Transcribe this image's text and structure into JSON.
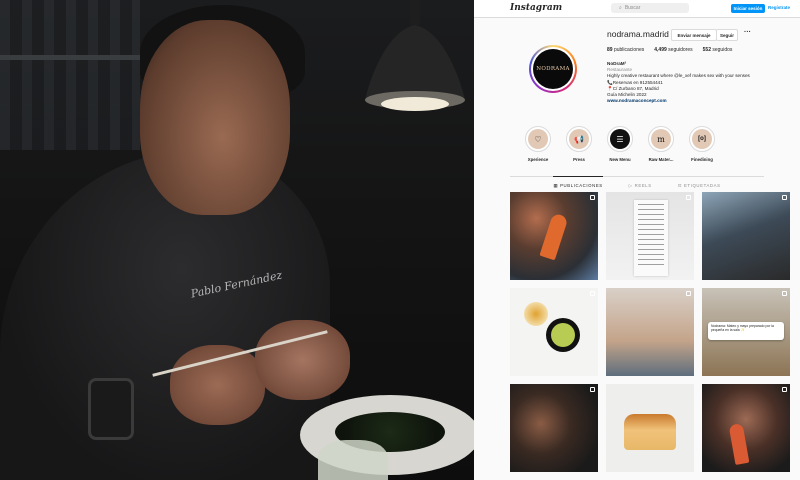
{
  "photo": {
    "embroidery": "Pablo Fernández"
  },
  "header": {
    "logo": "Instagram",
    "search_placeholder": "Buscar",
    "login_label": "Iniciar sesión",
    "signup_label": "Regístrate"
  },
  "profile": {
    "username": "nodrama.madrid",
    "avatar_text": "NODRAMA",
    "message_label": "Enviar mensaje",
    "follow_label": "Seguir",
    "more_label": "···",
    "stats": {
      "posts": "89",
      "posts_label": "publicaciones",
      "followers": "4,499",
      "followers_label": "seguidores",
      "following": "552",
      "following_label": "seguidos"
    },
    "bio": {
      "name": "NoDraM²",
      "category": "Restaurante",
      "line1": "Highly creative restaurant where @le_xef makes sex with your senses",
      "line2": "📞Reservas en 912554441",
      "line3": "📍C/ Zurbano 87, Madrid",
      "line4": "Guía Michelin 2022",
      "link": "www.nodramaconcept.com"
    }
  },
  "highlights": [
    {
      "label": "Xperience",
      "icon": "heart-chat-icon",
      "color": "#e2c9b6",
      "glyph": "♡"
    },
    {
      "label": "Press",
      "icon": "megaphone-icon",
      "color": "#e2c9b6",
      "glyph": "📢"
    },
    {
      "label": "New Menu",
      "icon": "menu-list-icon",
      "color": "#111111",
      "glyph": "☰"
    },
    {
      "label": "Raw Mater...",
      "icon": "m-logo-icon",
      "color": "#e2c9b6",
      "glyph": "m"
    },
    {
      "label": "Finedining",
      "icon": "camera-frame-icon",
      "color": "#e2c9b6",
      "glyph": "[o]"
    }
  ],
  "tabs": [
    {
      "label": "PUBLICACIONES",
      "icon": "grid-icon",
      "glyph": "▦",
      "active": true
    },
    {
      "label": "REELS",
      "icon": "reels-icon",
      "glyph": "▷",
      "active": false
    },
    {
      "label": "ETIQUETADAS",
      "icon": "tag-icon",
      "glyph": "⊡",
      "active": false
    }
  ],
  "posts": {
    "tile6_card": "Nodrama: Mateo y mayo preparado por la pequeña en la sala ✨"
  }
}
